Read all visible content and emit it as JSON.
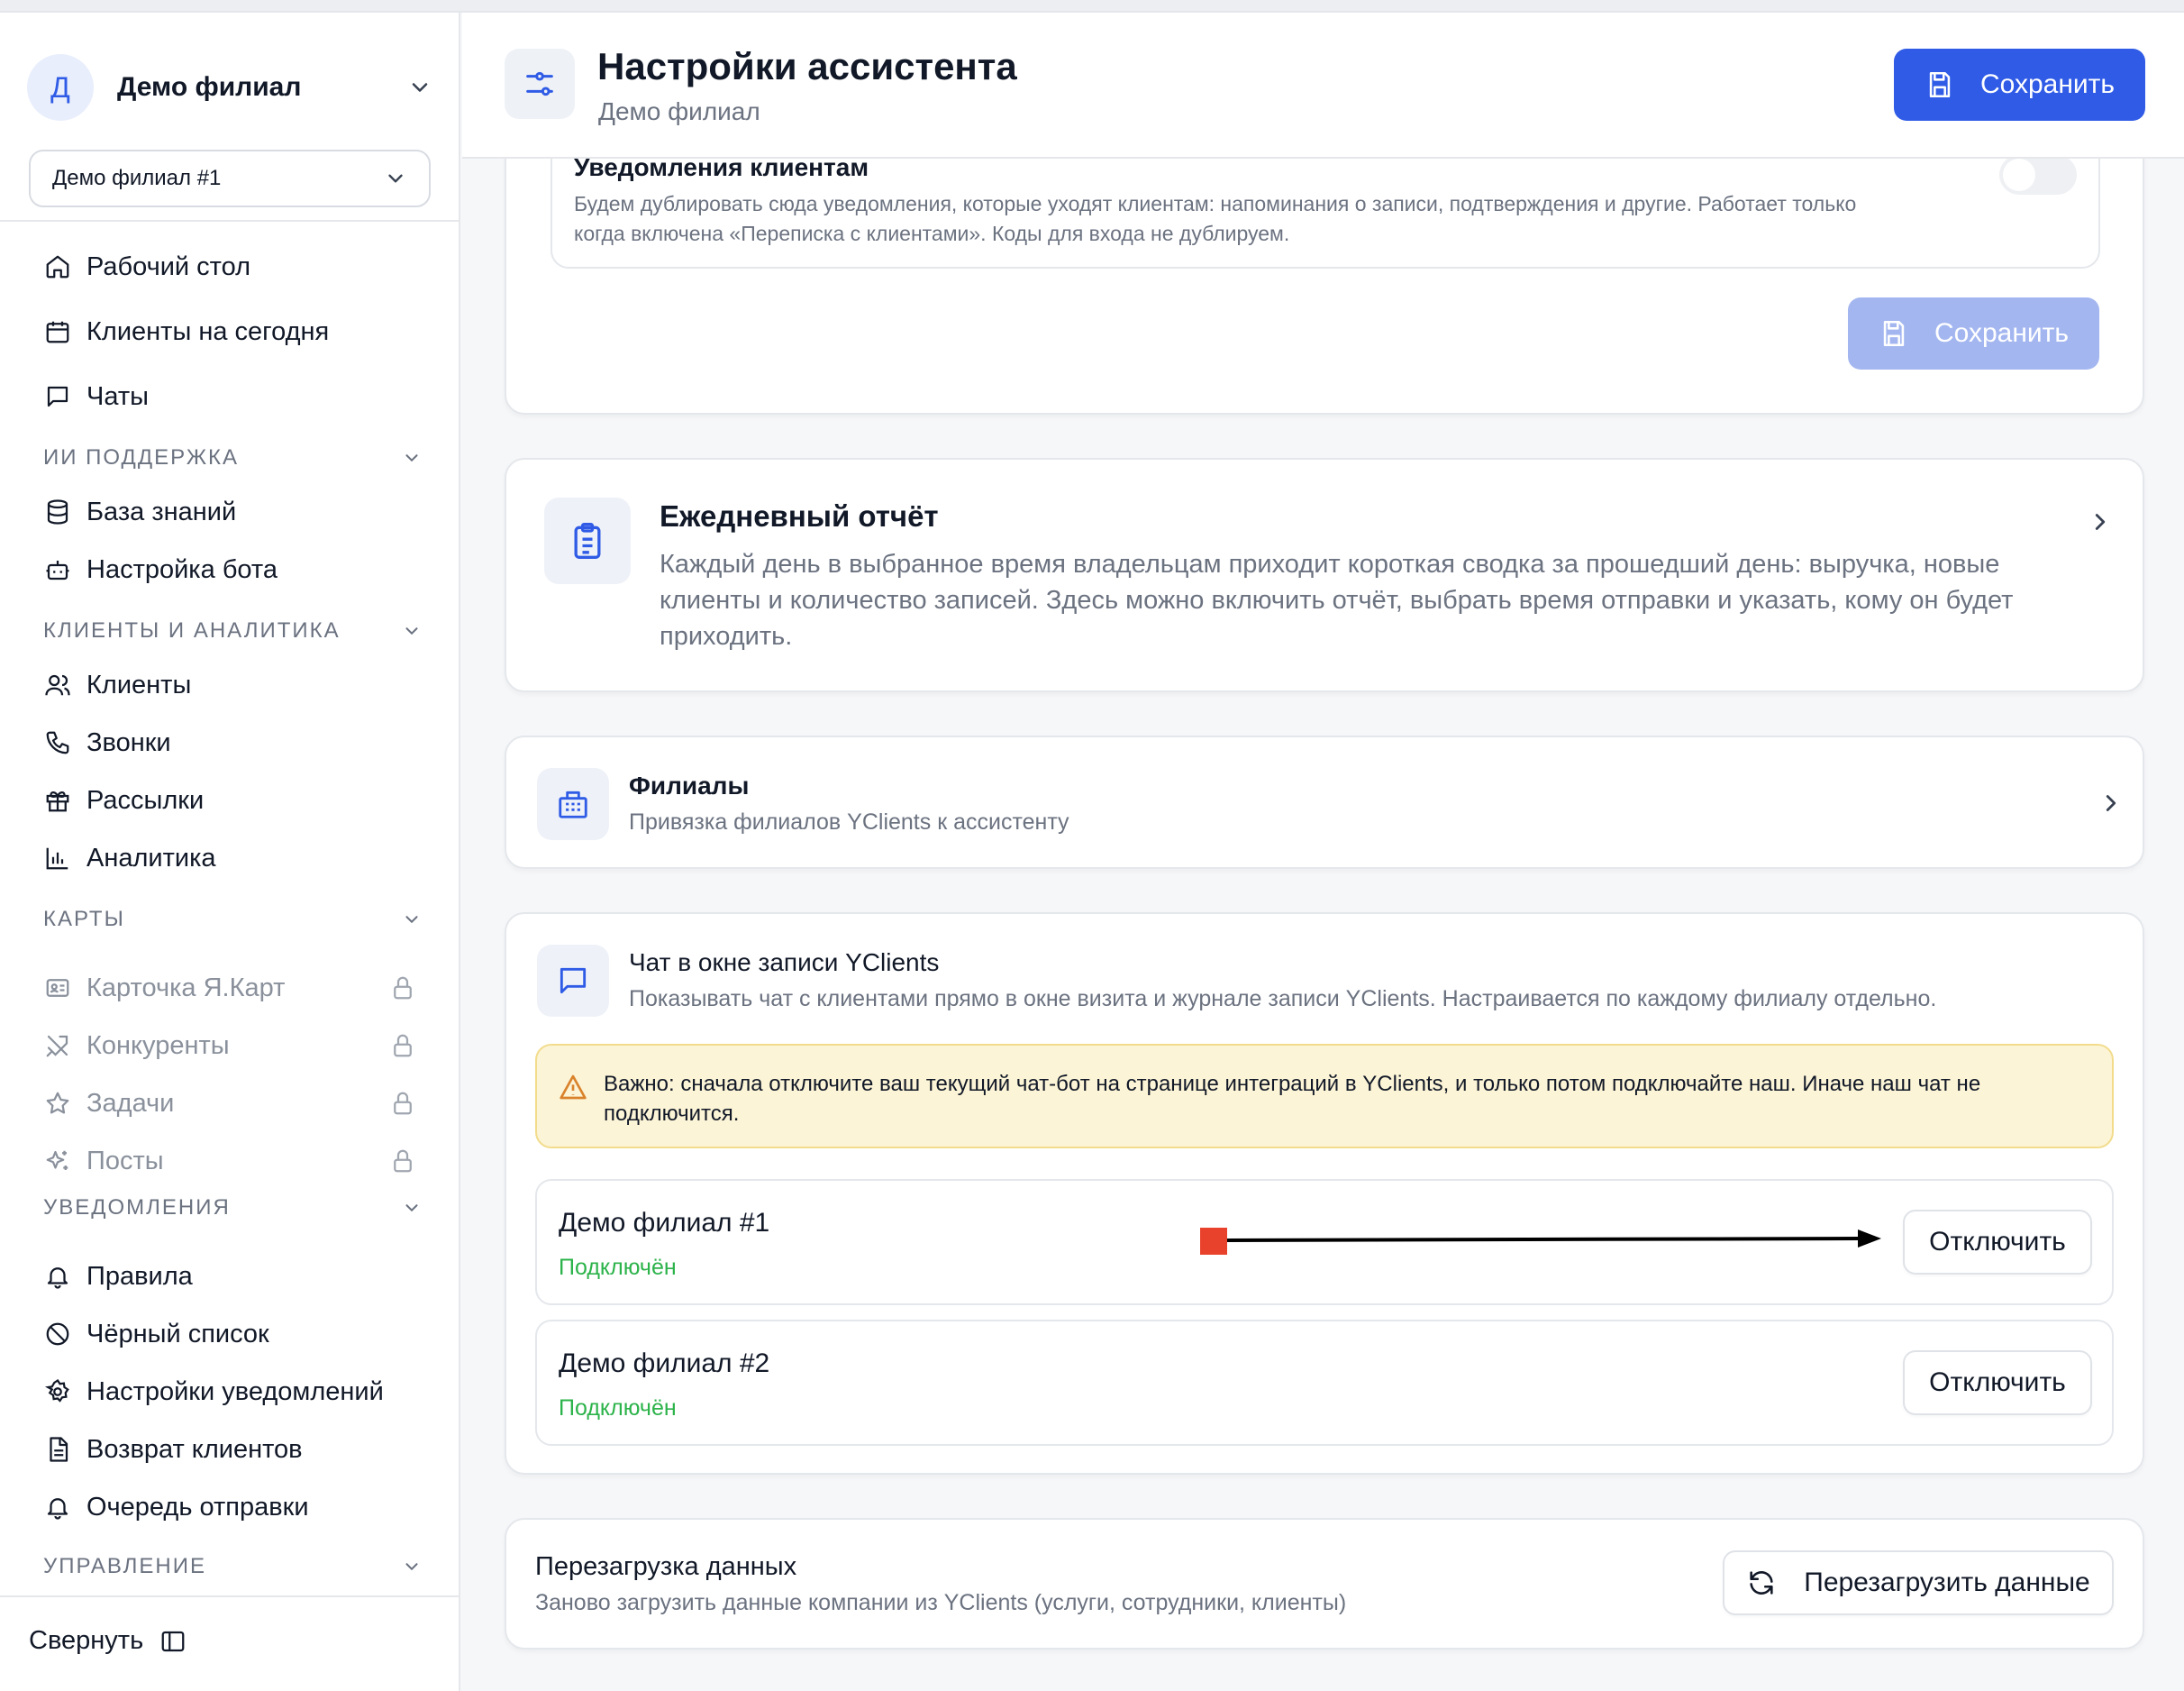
{
  "sidebar": {
    "org": {
      "avatar_letter": "Д",
      "name": "Демо филиал"
    },
    "branch_select": {
      "value": "Демо филиал #1"
    },
    "items": {
      "desk": "Рабочий стол",
      "clients_today": "Клиенты на сегодня",
      "chats": "Чаты",
      "knowledge": "База знаний",
      "bot_settings": "Настройка бота",
      "clients": "Клиенты",
      "calls": "Звонки",
      "mailings": "Рассылки",
      "analytics": "Аналитика",
      "ya_card": "Карточка Я.Карт",
      "competitors": "Конкуренты",
      "tasks": "Задачи",
      "posts": "Посты",
      "rules": "Правила",
      "blacklist": "Чёрный список",
      "notif_settings": "Настройки уведомлений",
      "return_clients": "Возврат клиентов",
      "queue": "Очередь отправки"
    },
    "sections": {
      "ai_support": "ИИ ПОДДЕРЖКА",
      "clients_analytics": "КЛИЕНТЫ И АНАЛИТИКА",
      "maps": "КАРТЫ",
      "notifications": "УВЕДОМЛЕНИЯ",
      "management": "УПРАВЛЕНИЕ"
    },
    "collapse_label": "Свернуть"
  },
  "header": {
    "title": "Настройки ассистента",
    "subtitle": "Демо филиал",
    "save_label": "Сохранить"
  },
  "notifications_card": {
    "title": "Уведомления клиентам",
    "description": "Будем дублировать сюда уведомления, которые уходят клиентам: напоминания о записи, подтверждения и другие. Работает только когда включена «Переписка с клиентами». Коды для входа не дублируем.",
    "toggle_on": false,
    "save_label": "Сохранить"
  },
  "daily_report": {
    "title": "Ежедневный отчёт",
    "description": "Каждый день в выбранное время владельцам приходит короткая сводка за прошедший день: выручка, новые клиенты и количество записей. Здесь можно включить отчёт, выбрать время отправки и указать, кому он будет приходить."
  },
  "branches": {
    "title": "Филиалы",
    "description": "Привязка филиалов YClients к ассистенту"
  },
  "chat_widget": {
    "title": "Чат в окне записи YClients",
    "description": "Показывать чат с клиентами прямо в окне визита и журнале записи YClients. Настраивается по каждому филиалу отдельно.",
    "warning": "Важно: сначала отключите ваш текущий чат-бот на странице интеграций в YClients, и только потом подключайте наш. Иначе наш чат не подключится.",
    "rows": [
      {
        "name": "Демо филиал #1",
        "status": "Подключён",
        "action": "Отключить"
      },
      {
        "name": "Демо филиал #2",
        "status": "Подключён",
        "action": "Отключить"
      }
    ]
  },
  "reload": {
    "title": "Перезагрузка данных",
    "description": "Заново загрузить данные компании из YClients (услуги, сотрудники, клиенты)",
    "button": "Перезагрузить данные"
  },
  "colors": {
    "primary": "#2f5be6",
    "primary_disabled": "#a3b6f0",
    "success": "#2cb34a",
    "warning_bg": "#fcf4d6",
    "annotation_marker": "#e8412c"
  }
}
